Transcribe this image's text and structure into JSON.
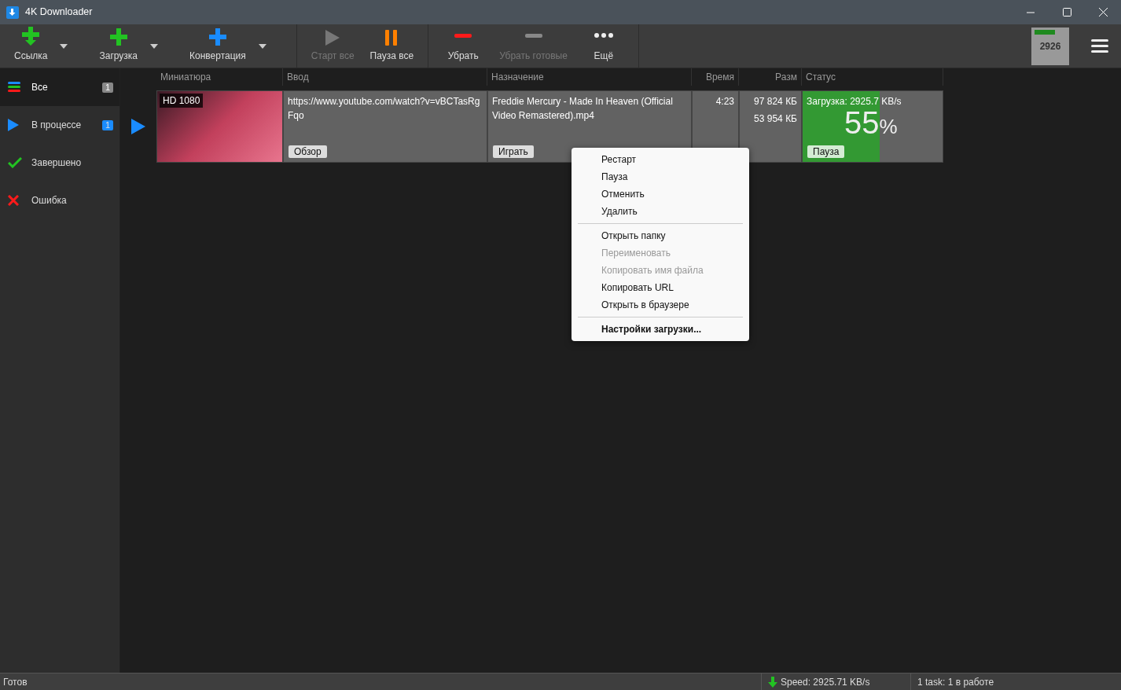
{
  "window": {
    "title": "4K Downloader"
  },
  "toolbar": {
    "groups": [
      [
        {
          "kind": "add-link",
          "label": "Ссылка",
          "disabled": false,
          "dropdown": true
        },
        {
          "kind": "add-download",
          "label": "Загрузка",
          "disabled": false,
          "dropdown": true
        },
        {
          "kind": "add-convert",
          "label": "Конвертация",
          "disabled": false,
          "dropdown": true
        }
      ],
      [
        {
          "kind": "start",
          "label": "Старт все",
          "disabled": true,
          "dropdown": false
        },
        {
          "kind": "pause",
          "label": "Пауза все",
          "disabled": false,
          "dropdown": false
        }
      ],
      [
        {
          "kind": "remove",
          "label": "Убрать",
          "disabled": false,
          "dropdown": false
        },
        {
          "kind": "remove-done",
          "label": "Убрать готовые",
          "disabled": true,
          "dropdown": false
        },
        {
          "kind": "more",
          "label": "Ещё",
          "disabled": false,
          "dropdown": false
        }
      ]
    ],
    "speed_widget": "2926"
  },
  "sidebar": {
    "items": [
      {
        "kind": "all",
        "label": "Все",
        "count": "1",
        "selected": true
      },
      {
        "kind": "progress",
        "label": "В процессе",
        "count": "1",
        "selected": false
      },
      {
        "kind": "done",
        "label": "Завершено",
        "selected": false
      },
      {
        "kind": "error",
        "label": "Ошибка",
        "selected": false
      }
    ]
  },
  "table": {
    "columns": [
      "Миниатюра",
      "Ввод",
      "Назначение",
      "Время",
      "Разм",
      "Статус"
    ],
    "rows": [
      {
        "active": true,
        "quality": "HD 1080",
        "url": "https://www.youtube.com/watch?v=vBCTasRgFqo",
        "browse": "Обзор",
        "destination": "Freddie Mercury - Made In Heaven (Official Video Remastered).mp4",
        "play": "Играть",
        "time": "4:23",
        "size_total": "97 824 КБ",
        "size_done": "53 954 КБ",
        "status": "Загрузка: 2925.7 KB/s",
        "percent": "55",
        "percent_sign": "%",
        "level": 0.55,
        "pause": "Пауза"
      }
    ]
  },
  "context_menu": {
    "groups": [
      [
        {
          "label": "Рестарт",
          "disabled": false,
          "bold": false
        },
        {
          "label": "Пауза",
          "disabled": false,
          "bold": false
        },
        {
          "label": "Отменить",
          "disabled": false,
          "bold": false
        },
        {
          "label": "Удалить",
          "disabled": false,
          "bold": false
        }
      ],
      [
        {
          "label": "Открыть папку",
          "disabled": false,
          "bold": false
        },
        {
          "label": "Переименовать",
          "disabled": true,
          "bold": false
        },
        {
          "label": "Копировать имя файла",
          "disabled": true,
          "bold": false
        },
        {
          "label": "Копировать URL",
          "disabled": false,
          "bold": false
        },
        {
          "label": "Открыть в браузере",
          "disabled": false,
          "bold": false
        }
      ],
      [
        {
          "label": "Настройки загрузки...",
          "disabled": false,
          "bold": true
        }
      ]
    ]
  },
  "status_bar": {
    "state": "Готов",
    "speed": "Speed: 2925.71 KB/s",
    "tasks": "1 task: 1 в работе"
  }
}
